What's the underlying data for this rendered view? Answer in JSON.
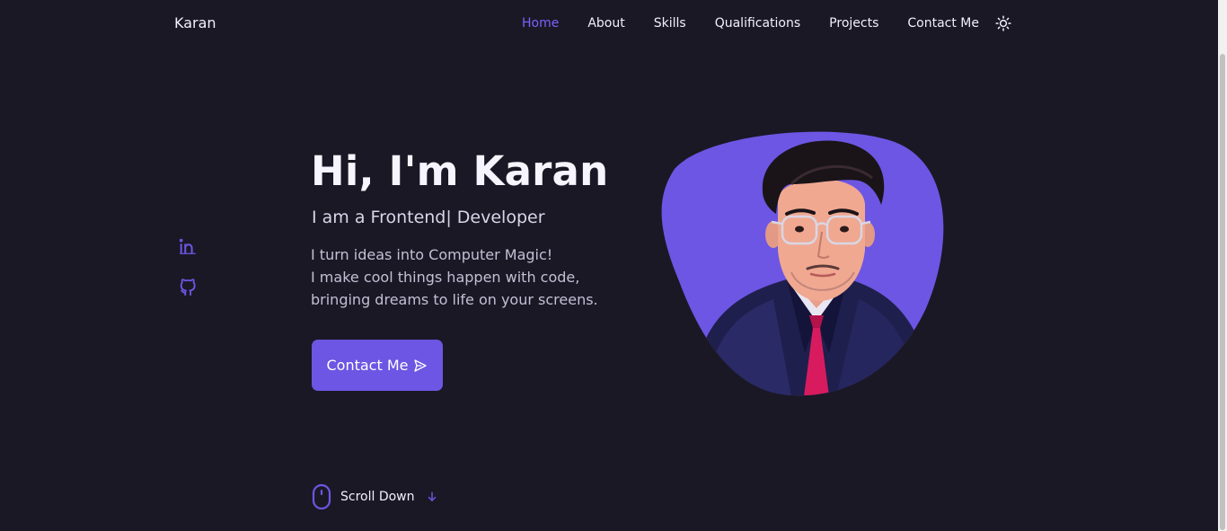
{
  "brand": {
    "name": "Karan"
  },
  "nav": {
    "items": [
      {
        "label": "Home",
        "active": true
      },
      {
        "label": "About"
      },
      {
        "label": "Skills"
      },
      {
        "label": "Qualifications"
      },
      {
        "label": "Projects"
      },
      {
        "label": "Contact Me"
      }
    ],
    "theme_toggle_icon": "sun-icon"
  },
  "social": {
    "icons": [
      "linkedin-icon",
      "github-icon"
    ]
  },
  "hero": {
    "title": "Hi, I'm Karan",
    "subtitle": "I am a Frontend| Developer",
    "description_lines": [
      "I turn ideas into Computer Magic!",
      "I make cool things happen with code,",
      "bringing dreams to life on your screens."
    ],
    "button_label": "Contact Me",
    "button_icon": "send-icon"
  },
  "scroll": {
    "label": "Scroll Down",
    "icons": [
      "mouse-icon",
      "arrow-down-icon"
    ]
  },
  "colors": {
    "background": "#1a1825",
    "accent": "#6c56e3",
    "accent_text": "#7b61ff",
    "text": "#f2f0fa"
  }
}
